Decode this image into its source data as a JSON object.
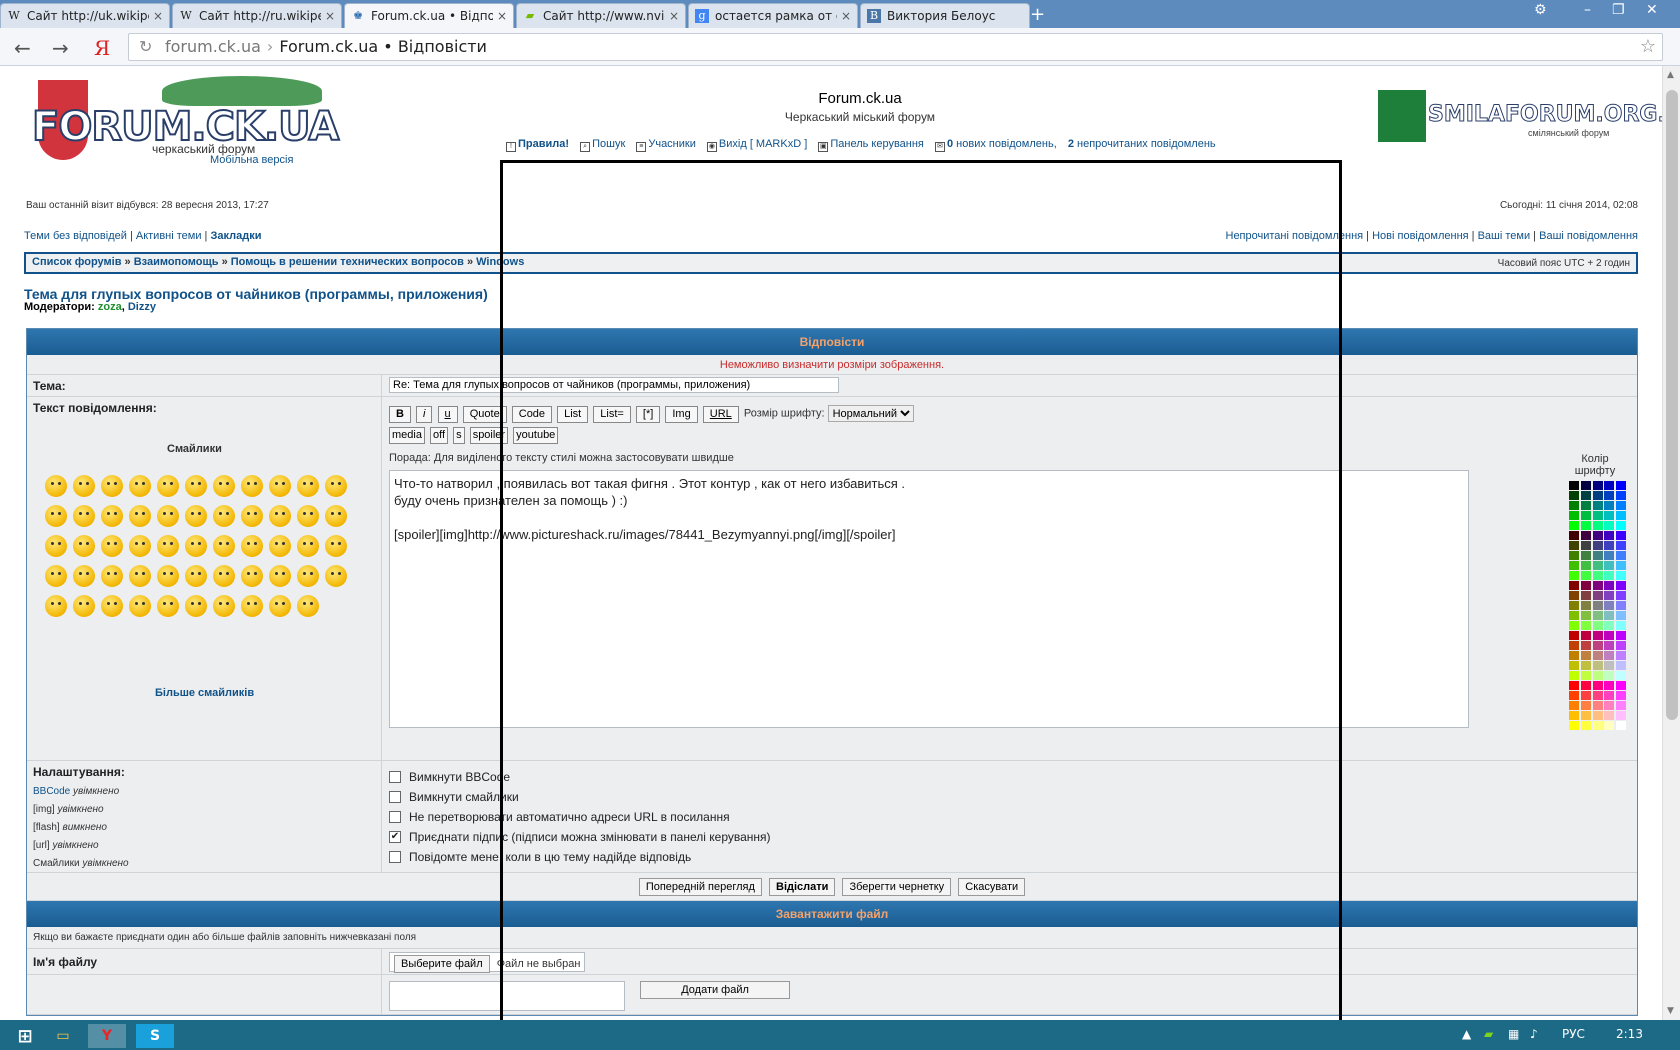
{
  "browser": {
    "tabs": [
      {
        "favicon": "W",
        "title": "Сайт http://uk.wikipe"
      },
      {
        "favicon": "W",
        "title": "Сайт http://ru.wikiped"
      },
      {
        "favicon": "♚",
        "title": "Forum.ck.ua • Відпові"
      },
      {
        "favicon": "▰",
        "title": "Сайт http://www.nvid"
      },
      {
        "favicon": "g",
        "title": "остается рамка от ок"
      },
      {
        "favicon": "B",
        "title": "Виктория Белоус"
      }
    ],
    "address": {
      "domain": "forum.ck.ua",
      "title": "Forum.ck.ua • Відповісти"
    }
  },
  "site": {
    "title": "Forum.ck.ua",
    "description": "Черкаський міський форум",
    "logo_text": "FORUM.CK.UA",
    "logo_sub": "черкаський форум",
    "mobile_link": "Мобільна версія",
    "partner_logo": "SMILAFORUM.ORG.UA",
    "partner_sub": "смілянський форум"
  },
  "topnav": {
    "rules": "Правила!",
    "search": "Пошук",
    "members": "Учасники",
    "logout": "Вихід [ MARKxD ]",
    "control_panel": "Панель керування",
    "new_count": "0",
    "new_label": "нових повідомлень,",
    "unread_count": "2",
    "unread_label": "непрочитаних повідомлень"
  },
  "info": {
    "last_visit": "Ваш останній візит відбувся: 28 вересня 2013, 17:27",
    "today": "Сьогодні: 11 січня 2014, 02:08"
  },
  "links_left": [
    "Теми без відповідей",
    "Активні теми",
    "Закладки"
  ],
  "links_right": [
    "Непрочитані повідомлення",
    "Нові повідомлення",
    "Ваші теми",
    "Ваші повідомлення"
  ],
  "breadcrumbs": [
    "Список форумів",
    "Взаимопомощь",
    "Помощь в решении технических вопросов",
    "Windows"
  ],
  "timezone": "Часовий пояс UTC + 2 годин",
  "topic": {
    "title": "Тема для глупых вопросов от чайников (программы, приложения)",
    "moderators_label": "Модератори:",
    "moderators": [
      "zoza",
      "Dizzy"
    ]
  },
  "reply": {
    "header": "Відповісти",
    "error": "Неможливо визначити розміри зображення.",
    "subject_label": "Тема:",
    "subject_value": "Re: Тема для глупых вопросов от чайников (программы, приложения)",
    "message_label": "Текст повідомлення:",
    "smilies_title": "Смайлики",
    "more_smilies": "Більше смайликів",
    "bbcode_buttons": [
      "B",
      "i",
      "u",
      "Quote",
      "Code",
      "List",
      "List=",
      "[*]",
      "Img",
      "URL"
    ],
    "font_size_label": "Розмір шрифту:",
    "font_size_value": "Нормальний",
    "extra_buttons": [
      "media",
      "off",
      "s",
      "spoiler",
      "youtube"
    ],
    "hint": "Порада:  Для виділеного тексту стилі можна застосовувати швидше",
    "message_text": "Что-то натворил , появилась вот такая фигня . Этот контур , как от него избавиться .\nбуду очень признателен за помощь ) :)\n\n[spoiler][img]http://www.pictureshack.ru/images/78441_Bezymyannyi.png[/img][/spoiler]",
    "font_color_label": "Колір шрифту",
    "settings_label": "Налаштування:",
    "settings_status": [
      {
        "name": "BBCode",
        "state": "увімкнено"
      },
      {
        "name": "[img]",
        "state": "увімкнено"
      },
      {
        "name": "[flash]",
        "state": "вимкнено"
      },
      {
        "name": "[url]",
        "state": "увімкнено"
      },
      {
        "name": "Смайлики",
        "state": "увімкнено"
      }
    ],
    "options": [
      {
        "label": "Вимкнути BBCode",
        "checked": false
      },
      {
        "label": "Вимкнути смайлики",
        "checked": false
      },
      {
        "label": "Не перетворювати автоматично адреси URL в посилання",
        "checked": false
      },
      {
        "label": "Приєднати підпис (підписи можна змінювати в панелі керування)",
        "checked": true
      },
      {
        "label": "Повідомте мене, коли в цю тему надійде відповідь",
        "checked": false
      }
    ],
    "buttons": {
      "preview": "Попередній перегляд",
      "submit": "Відіслати",
      "draft": "Зберегти чернетку",
      "cancel": "Скасувати"
    }
  },
  "upload": {
    "header": "Завантажити файл",
    "hint": "Якщо ви бажаєте приєднати один або більше файлів заповніть нижчевказані поля",
    "filename_label": "Ім'я файлу",
    "choose_button": "Выберите файл",
    "no_file": "Файл не выбран",
    "add_button": "Додати файл"
  },
  "taskbar": {
    "language": "РУС",
    "clock": "2:13"
  },
  "palette_colors": [
    "#000000",
    "#000040",
    "#000080",
    "#0000bf",
    "#0000ff",
    "#004000",
    "#004040",
    "#004080",
    "#0040bf",
    "#0040ff",
    "#008000",
    "#008040",
    "#008080",
    "#0080bf",
    "#0080ff",
    "#00bf00",
    "#00bf40",
    "#00bf80",
    "#00bfbf",
    "#00bfff",
    "#00ff00",
    "#00ff40",
    "#00ff80",
    "#00ffbf",
    "#00ffff",
    "#400000",
    "#400040",
    "#400080",
    "#4000bf",
    "#4000ff",
    "#404000",
    "#404040",
    "#404080",
    "#4040bf",
    "#4040ff",
    "#408000",
    "#408040",
    "#408080",
    "#4080bf",
    "#4080ff",
    "#40bf00",
    "#40bf40",
    "#40bf80",
    "#40bfbf",
    "#40bfff",
    "#40ff00",
    "#40ff40",
    "#40ff80",
    "#40ffbf",
    "#40ffff",
    "#800000",
    "#800040",
    "#800080",
    "#8000bf",
    "#8000ff",
    "#804000",
    "#804040",
    "#804080",
    "#8040bf",
    "#8040ff",
    "#808000",
    "#808040",
    "#808080",
    "#8080bf",
    "#8080ff",
    "#80bf00",
    "#80bf40",
    "#80bf80",
    "#80bfbf",
    "#80bfff",
    "#80ff00",
    "#80ff40",
    "#80ff80",
    "#80ffbf",
    "#80ffff",
    "#bf0000",
    "#bf0040",
    "#bf0080",
    "#bf00bf",
    "#bf00ff",
    "#bf4000",
    "#bf4040",
    "#bf4080",
    "#bf40bf",
    "#bf40ff",
    "#bf8000",
    "#bf8040",
    "#bf8080",
    "#bf80bf",
    "#bf80ff",
    "#bfbf00",
    "#bfbf40",
    "#bfbf80",
    "#bfbfbf",
    "#bfbfff",
    "#bfff00",
    "#bfff40",
    "#bfff80",
    "#bfffbf",
    "#bfffff",
    "#ff0000",
    "#ff0040",
    "#ff0080",
    "#ff00bf",
    "#ff00ff",
    "#ff4000",
    "#ff4040",
    "#ff4080",
    "#ff40bf",
    "#ff40ff",
    "#ff8000",
    "#ff8040",
    "#ff8080",
    "#ff80bf",
    "#ff80ff",
    "#ffbf00",
    "#ffbf40",
    "#ffbf80",
    "#ffbfbf",
    "#ffbfff",
    "#ffff00",
    "#ffff40",
    "#ffff80",
    "#ffffbf",
    "#ffffff"
  ]
}
